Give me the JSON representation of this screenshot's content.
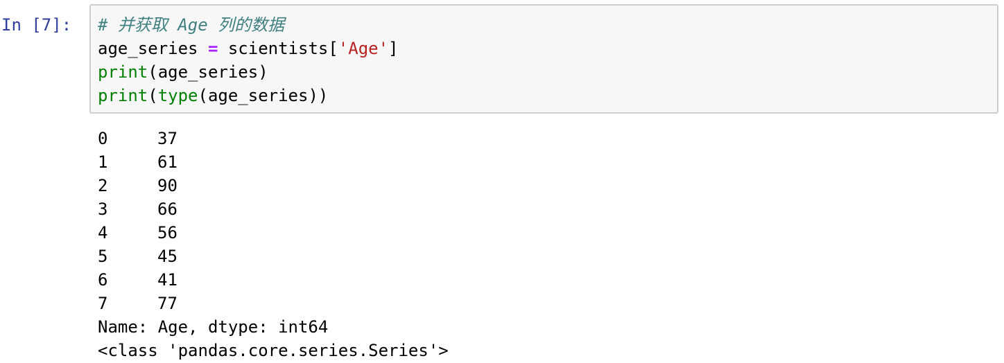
{
  "cell": {
    "prompt": "In [7]:",
    "code": {
      "comment": "# 并获取 Age 列的数据",
      "line2": {
        "var": "age_series ",
        "op": "=",
        "expr_pre": " scientists[",
        "str": "'Age'",
        "expr_post": "]"
      },
      "line3": {
        "fn": "print",
        "args": "(age_series)"
      },
      "line4": {
        "fn1": "print",
        "open": "(",
        "fn2": "type",
        "args": "(age_series))"
      }
    },
    "output": {
      "rows": [
        {
          "index": "0",
          "value": "37"
        },
        {
          "index": "1",
          "value": "61"
        },
        {
          "index": "2",
          "value": "90"
        },
        {
          "index": "3",
          "value": "66"
        },
        {
          "index": "4",
          "value": "56"
        },
        {
          "index": "5",
          "value": "45"
        },
        {
          "index": "6",
          "value": "41"
        },
        {
          "index": "7",
          "value": "77"
        }
      ],
      "footer": "Name: Age, dtype: int64",
      "type_line": "<class 'pandas.core.series.Series'>"
    }
  }
}
